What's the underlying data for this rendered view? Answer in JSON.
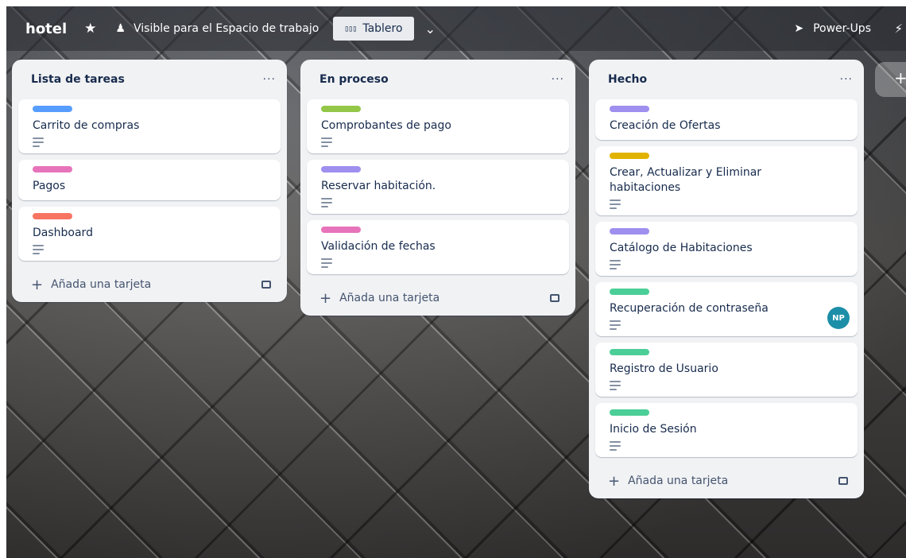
{
  "header": {
    "board_title": "hotel",
    "star_icon": "star-icon",
    "visibility_label": "Visible para el Espacio de trabajo",
    "view_label": "Tablero",
    "powerups_label": "Power-Ups"
  },
  "colors": {
    "blue": "#579dff",
    "green": "#94c748",
    "pink": "#e774bb",
    "red": "#f87462",
    "purple": "#9f8fef",
    "yellow": "#e2b203",
    "teal": "#4bce97"
  },
  "lists": [
    {
      "title": "Lista de tareas",
      "menu": "···",
      "cards": [
        {
          "title": "Carrito de compras",
          "label_color": "blue"
        },
        {
          "title": "Pagos",
          "label_color": "pink"
        },
        {
          "title": "Dashboard",
          "label_color": "red"
        }
      ],
      "add_label": "Añada una tarjeta"
    },
    {
      "title": "En proceso",
      "menu": "···",
      "cards": [
        {
          "title": "Comprobantes de pago",
          "label_color": "green"
        },
        {
          "title": "Reservar habitación.",
          "label_color": "purple"
        },
        {
          "title": "Validación de fechas",
          "label_color": "pink"
        }
      ],
      "add_label": "Añada una tarjeta"
    },
    {
      "title": "Hecho",
      "menu": "···",
      "cards": [
        {
          "title": "Creación de Ofertas",
          "label_color": "purple"
        },
        {
          "title": "Crear, Actualizar y Eliminar habitaciones",
          "label_color": "yellow"
        },
        {
          "title": "Catálogo de Habitaciones",
          "label_color": "purple"
        },
        {
          "title": "Recuperación de contraseña",
          "label_color": "teal",
          "avatar": "NP"
        },
        {
          "title": "Registro de Usuario",
          "label_color": "teal"
        },
        {
          "title": "Inicio de Sesión",
          "label_color": "teal"
        }
      ],
      "add_label": "Añada una tarjeta"
    }
  ],
  "add_list_label": "+"
}
